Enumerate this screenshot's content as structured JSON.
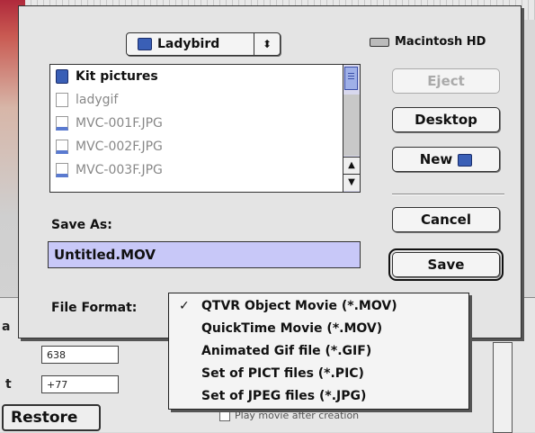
{
  "dialog": {
    "folder_popup": "Ladybird",
    "disk_name": "Macintosh HD",
    "files": [
      {
        "name": "Kit pictures",
        "kind": "folder"
      },
      {
        "name": "ladygif",
        "kind": "doc"
      },
      {
        "name": "MVC-001F.JPG",
        "kind": "img"
      },
      {
        "name": "MVC-002F.JPG",
        "kind": "img"
      },
      {
        "name": "MVC-003F.JPG",
        "kind": "img"
      }
    ],
    "buttons": {
      "eject": "Eject",
      "desktop": "Desktop",
      "new": "New",
      "cancel": "Cancel",
      "save": "Save"
    },
    "save_as_label": "Save As:",
    "save_as_value": "Untitled.MOV",
    "file_format_label": "File Format:"
  },
  "format_menu": {
    "items": [
      "QTVR Object Movie (*.MOV)",
      "QuickTime Movie (*.MOV)",
      "Animated Gif file (*.GIF)",
      "Set of PICT files (*.PIC)",
      "Set of JPEG files (*.JPG)"
    ],
    "checked_index": 0,
    "check_mark": "✓"
  },
  "background": {
    "field1": "638",
    "field2": "+77",
    "label_a": "a",
    "label_b": "t",
    "restore": "Restore",
    "play_option": "Play movie after creation"
  },
  "icons": {
    "folder_arrows": "⬍",
    "scroll_up": "▲",
    "scroll_down": "▼"
  }
}
